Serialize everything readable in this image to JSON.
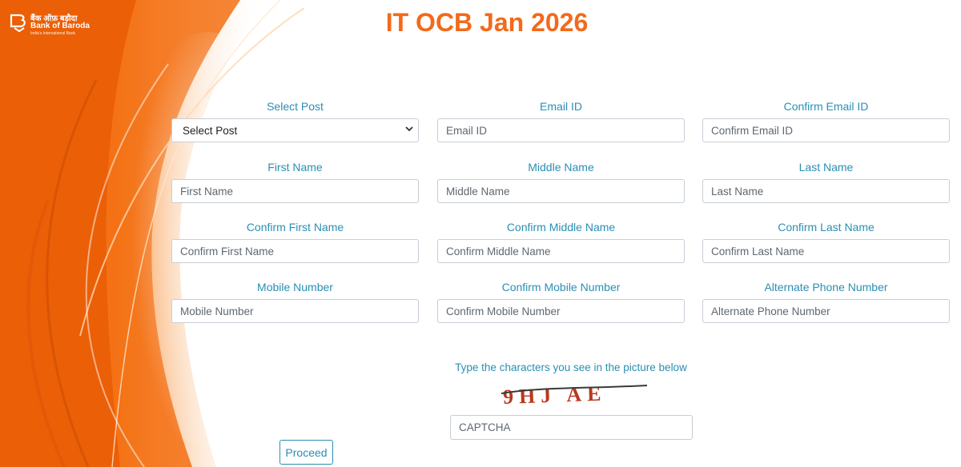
{
  "brand": {
    "hindi_name": "बैंक ऑफ़ बड़ौदा",
    "name": "Bank of Baroda",
    "tagline": "India's International Bank"
  },
  "page": {
    "title": "IT OCB Jan 2026"
  },
  "form": {
    "post_label": "Select Post",
    "post_options": [
      "Select Post"
    ],
    "email_label": "Email ID",
    "email_placeholder": "Email ID",
    "confirm_email_label": "Confirm Email ID",
    "confirm_email_placeholder": "Confirm Email ID",
    "first_name_label": "First Name",
    "first_name_placeholder": "First Name",
    "middle_name_label": "Middle Name",
    "middle_name_placeholder": "Middle Name",
    "last_name_label": "Last Name",
    "last_name_placeholder": "Last Name",
    "confirm_first_name_label": "Confirm First Name",
    "confirm_first_name_placeholder": "Confirm First Name",
    "confirm_middle_name_label": "Confirm Middle Name",
    "confirm_middle_name_placeholder": "Confirm Middle Name",
    "confirm_last_name_label": "Confirm Last Name",
    "confirm_last_name_placeholder": "Confirm Last Name",
    "mobile_label": "Mobile Number",
    "mobile_placeholder": "Mobile Number",
    "confirm_mobile_label": "Confirm Mobile Number",
    "confirm_mobile_placeholder": "Confirm Mobile Number",
    "alt_phone_label": "Alternate Phone Number",
    "alt_phone_placeholder": "Alternate Phone Number"
  },
  "captcha": {
    "instruction": "Type the characters you see in the picture below",
    "image_text": "9HJ AE",
    "placeholder": "CAPTCHA"
  },
  "actions": {
    "proceed_label": "Proceed"
  },
  "colors": {
    "brand_orange": "#f26a1b",
    "label_blue": "#2a8fb3",
    "captcha_red": "#b9381d"
  }
}
